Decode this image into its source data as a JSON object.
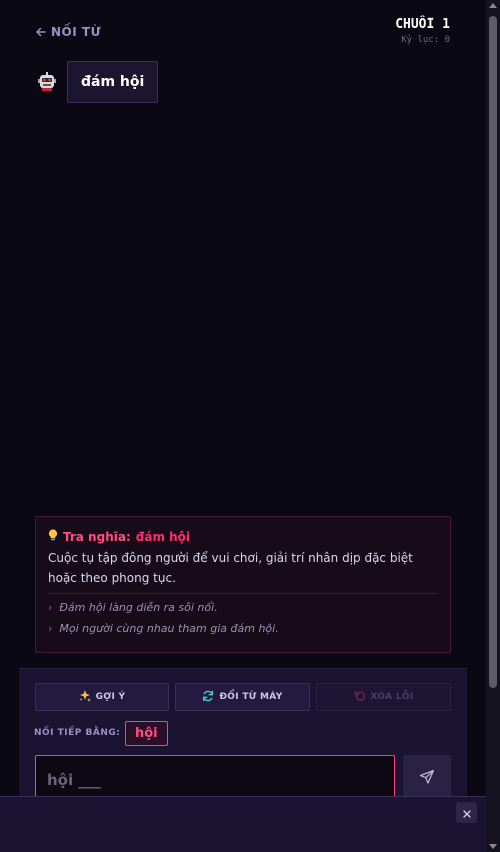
{
  "header": {
    "back_label": "NỐI TỪ",
    "streak_title": "CHUỖI 1",
    "streak_record": "Kỷ lục: 0"
  },
  "chat": {
    "bot_word": "đám hội"
  },
  "definition": {
    "title_prefix": "Tra nghĩa:",
    "title_word": "đám hội",
    "body": "Cuộc tụ tập đông người để vui chơi, giải trí nhân dịp đặc biệt hoặc theo phong tục.",
    "examples": [
      "Đám hội làng diễn ra sôi nổi.",
      "Mọi người cùng nhau tham gia đám hội."
    ]
  },
  "controls": {
    "hint_label": "GỢI Ý",
    "swap_label": "ĐỔI TỪ MÁY",
    "clear_label": "XÓA LỖI",
    "next_label": "NỐI TIẾP BẰNG:",
    "next_word": "hội",
    "input_placeholder": "hội ___",
    "input_value": ""
  },
  "colors": {
    "background": "#0a0812",
    "panel": "#1b1332",
    "accent": "#ff3f7b",
    "muted": "#9b8fc4"
  },
  "icons": {
    "back": "arrow-left-icon",
    "avatar": "robot-avatar-icon",
    "definition": "lightbulb-icon",
    "hint": "sparkle-icon",
    "swap": "refresh-icon",
    "clear": "undo-icon",
    "send": "send-icon",
    "close": "close-icon"
  }
}
